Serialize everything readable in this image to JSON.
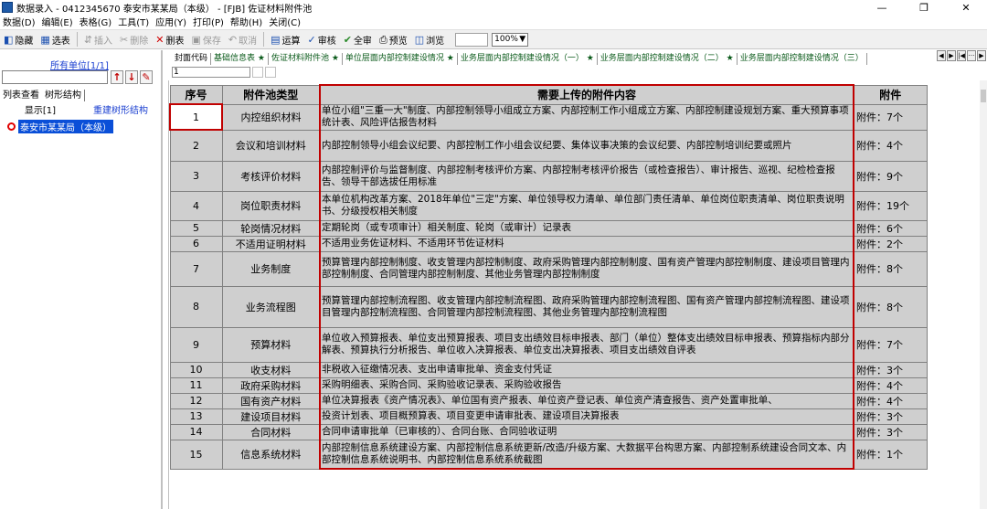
{
  "window": {
    "title": "数据录入 - 0412345670  泰安市某某局（本级） - [FJB] 佐证材料附件池",
    "minimize": "—",
    "maximize": "❐",
    "close": "✕"
  },
  "menu": [
    "数据(D)",
    "编辑(E)",
    "表格(G)",
    "工具(T)",
    "应用(Y)",
    "打印(P)",
    "帮助(H)",
    "关闭(C)"
  ],
  "toolbar": {
    "hide": "隐藏",
    "select_table": "选表",
    "insert": "插入",
    "delete": "删除",
    "delete_table": "删表",
    "save": "保存",
    "cancel": "取消",
    "calculate": "运算",
    "audit": "审核",
    "audit_all": "全审",
    "preview": "预览",
    "browse": "浏览",
    "zoom": "100%"
  },
  "left": {
    "unit_link": "所有单位[1/1]",
    "tab_list": "列表查看",
    "tab_tree": "树形结构",
    "display": "显示[1]",
    "rebuild": "重建树形结构",
    "tree_root": "泰安市某某局（本级）"
  },
  "tabs": [
    "封面代码",
    "基础信息表 ★",
    "佐证材料附件池 ★",
    "单位层面内部控制建设情况 ★",
    "业务层面内部控制建设情况（一） ★",
    "业务层面内部控制建设情况（二） ★",
    "业务层面内部控制建设情况（三）"
  ],
  "tab_nav": [
    "◀",
    "▶",
    "|◀",
    "···",
    "▶"
  ],
  "cell_ref": "1",
  "table": {
    "headers": [
      "序号",
      "附件池类型",
      "需要上传的附件内容",
      "附件"
    ],
    "rows": [
      {
        "no": "1",
        "type": "内控组织材料",
        "content": "单位小组\"三重一大\"制度、内部控制领导小组成立方案、内部控制工作小组成立方案、内部控制建设规划方案、重大预算事项统计表、风险评估报告材料",
        "count": "附件：7个"
      },
      {
        "no": "2",
        "type": "会议和培训材料",
        "content": "内部控制领导小组会议纪要、内部控制工作小组会议纪要、集体议事决策的会议纪要、内部控制培训纪要或照片",
        "count": "附件：4个"
      },
      {
        "no": "3",
        "type": "考核评价材料",
        "content": "内部控制评价与监督制度、内部控制考核评价方案、内部控制考核评价报告（或检查报告）、审计报告、巡视、纪检检查报告、领导干部选拔任用标准",
        "count": "附件：9个"
      },
      {
        "no": "4",
        "type": "岗位职责材料",
        "content": "本单位机构改革方案、2018年单位\"三定\"方案、单位领导权力清单、单位部门责任清单、单位岗位职责清单、岗位职责说明书、分级授权相关制度",
        "count": "附件：19个"
      },
      {
        "no": "5",
        "type": "轮岗情况材料",
        "content": "定期轮岗（或专项审计）相关制度、轮岗（或审计）记录表",
        "count": "附件：6个"
      },
      {
        "no": "6",
        "type": "不适用证明材料",
        "content": "不适用业务佐证材料、不适用环节佐证材料",
        "count": "附件：2个"
      },
      {
        "no": "7",
        "type": "业务制度",
        "content": "预算管理内部控制制度、收支管理内部控制制度、政府采购管理内部控制制度、国有资产管理内部控制制度、建设项目管理内部控制制度、合同管理内部控制制度、其他业务管理内部控制制度",
        "count": "附件：8个"
      },
      {
        "no": "8",
        "type": "业务流程图",
        "content": "预算管理内部控制流程图、收支管理内部控制流程图、政府采购管理内部控制流程图、国有资产管理内部控制流程图、建设项目管理内部控制流程图、合同管理内部控制流程图、其他业务管理内部控制流程图",
        "count": "附件：8个"
      },
      {
        "no": "9",
        "type": "预算材料",
        "content": "单位收入预算报表、单位支出预算报表、项目支出绩效目标申报表、部门（单位）整体支出绩效目标申报表、预算指标内部分解表、预算执行分析报告、单位收入决算报表、单位支出决算报表、项目支出绩效自评表",
        "count": "附件：7个"
      },
      {
        "no": "10",
        "type": "收支材料",
        "content": "非税收入征缴情况表、支出申请审批单、资金支付凭证",
        "count": "附件：3个"
      },
      {
        "no": "11",
        "type": "政府采购材料",
        "content": "采购明细表、采购合同、采购验收记录表、采购验收报告",
        "count": "附件：4个"
      },
      {
        "no": "12",
        "type": "国有资产材料",
        "content": "单位决算报表《资产情况表》、单位国有资产报表、单位资产登记表、单位资产清查报告、资产处置审批单、",
        "count": "附件：4个"
      },
      {
        "no": "13",
        "type": "建设项目材料",
        "content": "投资计划表、项目概预算表、项目变更申请审批表、建设项目决算报表",
        "count": "附件：3个"
      },
      {
        "no": "14",
        "type": "合同材料",
        "content": "合同申请审批单（已审核的）、合同台账、合同验收证明",
        "count": "附件：3个"
      },
      {
        "no": "15",
        "type": "信息系统材料",
        "content": "内部控制信息系统建设方案、内部控制信息系统更新/改造/升级方案、大数据平台构思方案、内部控制系统建设合同文本、内部控制信息系统说明书、内部控制信息系统系统截图",
        "count": "附件：1个"
      }
    ]
  }
}
